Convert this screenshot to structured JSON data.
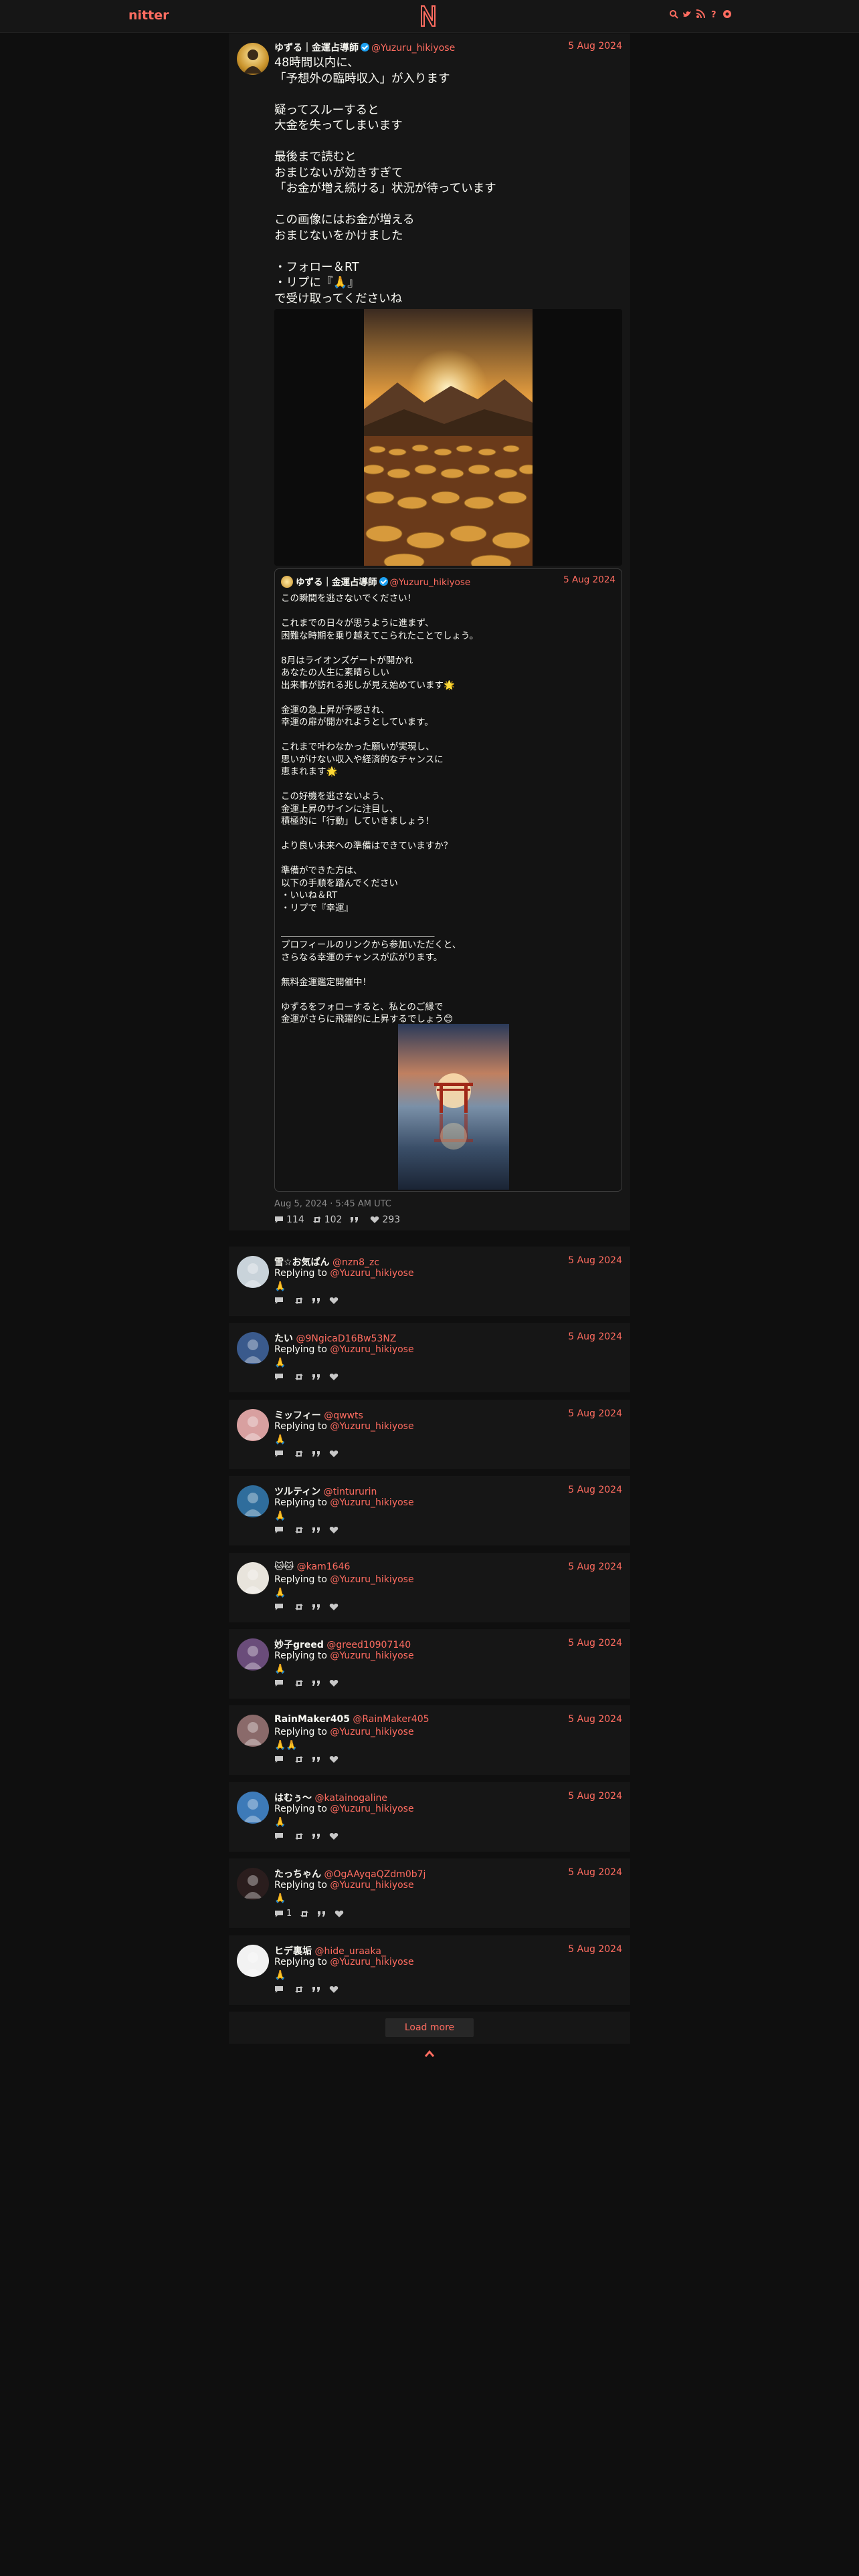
{
  "nav": {
    "brand": "nitter",
    "icons": [
      "search-icon",
      "rss-icon",
      "bird-icon",
      "info-icon",
      "settings-icon"
    ]
  },
  "main": {
    "name": "ゆずる｜金運占導師",
    "handle": "@Yuzuru_hikiyose",
    "date": "5 Aug 2024",
    "text": "48時間以内に、\n「予想外の臨時収入」が入ります\n\n疑ってスルーすると\n大金を失ってしまいます\n\n最後まで読むと\nおまじないが効きすぎて\n「お金が増え続ける」状況が待っています\n\nこの画像にはお金が増える\nおまじないをかけました\n\n・フォロー＆RT\n・リプに『🙏』\nで受け取ってくださいね",
    "timestamp": "Aug 5, 2024 · 5:45 AM UTC",
    "stats": {
      "replies": "114",
      "retweets": "102",
      "quotes": "",
      "likes": "293"
    },
    "quote": {
      "name": "ゆずる｜金運占導師",
      "handle": "@Yuzuru_hikiyose",
      "date": "5 Aug 2024",
      "text": "この瞬間を逃さないでください！\n\nこれまでの日々が思うように進まず、\n困難な時期を乗り越えてこられたことでしょう。\n\n8月はライオンズゲートが開かれ\nあなたの人生に素晴らしい\n出来事が訪れる兆しが見え始めています🌟\n\n金運の急上昇が予感され、\n幸運の扉が開かれようとしています。\n\nこれまで叶わなかった願いが実現し、\n思いがけない収入や経済的なチャンスに\n恵まれます🌟\n\nこの好機を逃さないよう、\n金運上昇のサインに注目し、\n積極的に「行動」していきましょう！\n\nより良い未来への準備はできていますか？\n\n準備ができた方は、\n以下の手順を踏んでください\n・いいね＆RT\n・リプで『幸運』\n\n＿＿＿＿＿＿＿＿＿＿＿＿＿＿＿＿＿\nプロフィールのリンクから参加いただくと、\nさらなる幸運のチャンスが広がります。\n\n無料金運鑑定開催中！\n\nゆずるをフォローすると、私とのご縁で\n金運がさらに飛躍的に上昇するでしょう😊"
    }
  },
  "replying_label": "Replying to",
  "replying_handle": "@Yuzuru_hikiyose",
  "replies": [
    {
      "name": "雪☆お気ぱん",
      "handle": "@nzn8_zc",
      "date": "5 Aug 2024",
      "text": "🙏",
      "replies": "",
      "color": "#c9d3da"
    },
    {
      "name": "たい",
      "handle": "@9NgicaD16Bw53NZ",
      "date": "5 Aug 2024",
      "text": "🙏",
      "replies": "",
      "color": "#3a5a8c"
    },
    {
      "name": "ミッフィー",
      "handle": "@qwwts",
      "date": "5 Aug 2024",
      "text": "🙏",
      "replies": "",
      "color": "#d8a0a0"
    },
    {
      "name": "ツルティン",
      "handle": "@tintururin",
      "date": "5 Aug 2024",
      "text": "🙏",
      "replies": "",
      "color": "#2f6d9c"
    },
    {
      "name": "🐱🐱",
      "handle": "@kam1646",
      "date": "5 Aug 2024",
      "text": "🙏",
      "replies": "",
      "color": "#e8e4dc"
    },
    {
      "name": "妙子greed",
      "handle": "@greed10907140",
      "date": "5 Aug 2024",
      "text": "🙏",
      "replies": "",
      "color": "#6a4c7a"
    },
    {
      "name": "RainMaker405",
      "handle": "@RainMaker405",
      "date": "5 Aug 2024",
      "text": "🙏🙏",
      "replies": "",
      "color": "#8a6a6a"
    },
    {
      "name": "はむぅ〜",
      "handle": "@katainogaline",
      "date": "5 Aug 2024",
      "text": "🙏",
      "replies": "",
      "color": "#3d7ab8"
    },
    {
      "name": "たっちゃん",
      "handle": "@OgAAyqaQZdm0b7j",
      "date": "5 Aug 2024",
      "text": "🙏",
      "replies": "1",
      "color": "#2a1d1d"
    },
    {
      "name": "ヒデ裏垢",
      "handle": "@hide_uraaka_",
      "date": "5 Aug 2024",
      "text": "🙏",
      "replies": "",
      "color": "#f2f2f2"
    }
  ],
  "load_more": "Load more",
  "colors": {
    "accent": "#ff6c60",
    "bg": "#0f0f0f",
    "panel": "#161616"
  }
}
